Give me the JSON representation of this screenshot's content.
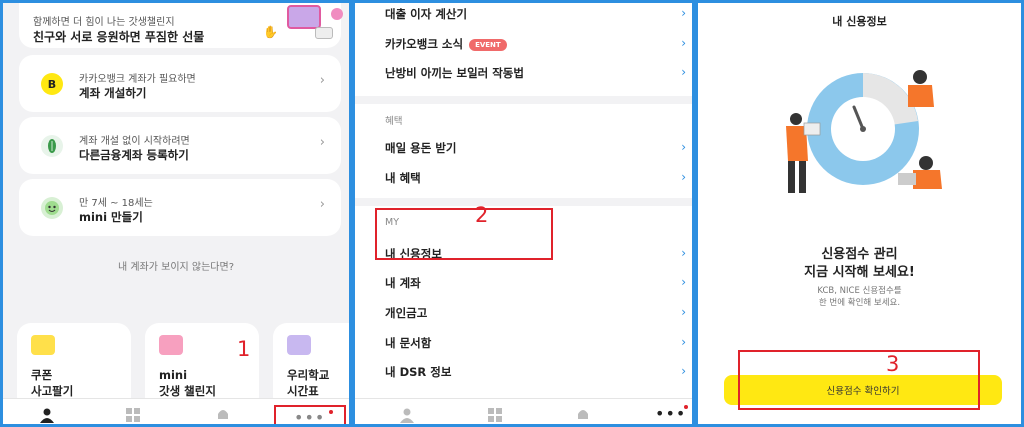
{
  "left_panel": {
    "promo": {
      "subtitle": "함께하면 더 힘이 나는 갓생챌린지",
      "title": "친구와 서로 응원하면 푸짐한 선물"
    },
    "cards": [
      {
        "subtitle": "카카오뱅크 계좌가 필요하면",
        "title": "계좌 개설하기",
        "icon_text": "B"
      },
      {
        "subtitle": "계좌 개설 없이 시작하려면",
        "title": "다른금융계좌 등록하기",
        "icon_text": ""
      },
      {
        "subtitle": "만 7세 ~ 18세는",
        "title": "mini 만들기",
        "icon_text": ""
      }
    ],
    "no_account_text": "내 계좌가 보이지 않는다면?",
    "tiles": [
      {
        "line1": "쿠폰",
        "line2": "사고팔기"
      },
      {
        "line1": "mini",
        "line2": "갓생 챌린지"
      },
      {
        "line1": "우리학교",
        "line2": "시간표"
      }
    ],
    "marker": "1"
  },
  "middle_panel": {
    "rows_top": [
      {
        "label": "대출 이자 계산기"
      },
      {
        "label": "카카오뱅크 소식",
        "badge": "EVENT"
      },
      {
        "label": "난방비 아끼는 보일러 작동법"
      }
    ],
    "section_benefit": "혜택",
    "rows_benefit": [
      {
        "label": "매일 용돈 받기"
      },
      {
        "label": "내 혜택"
      }
    ],
    "section_my": "MY",
    "rows_my": [
      {
        "label": "내 신용정보"
      },
      {
        "label": "내 계좌"
      },
      {
        "label": "개인금고"
      },
      {
        "label": "내 문서함"
      },
      {
        "label": "내 DSR 정보"
      }
    ],
    "marker": "2"
  },
  "right_panel": {
    "title": "내 신용정보",
    "headline_1": "신용점수 관리",
    "headline_2": "지금 시작해 보세요!",
    "desc_1": "KCB, NICE 신용점수를",
    "desc_2": "한 번에 확인해 보세요.",
    "button": "신용점수 확인하기",
    "marker": "3"
  },
  "colors": {
    "accent_yellow": "#ffe812",
    "annotation_red": "#e0222b",
    "panel_border_blue": "#2d8fe0",
    "gauge_blue": "#8cc8ec",
    "person_orange": "#f5762b"
  }
}
